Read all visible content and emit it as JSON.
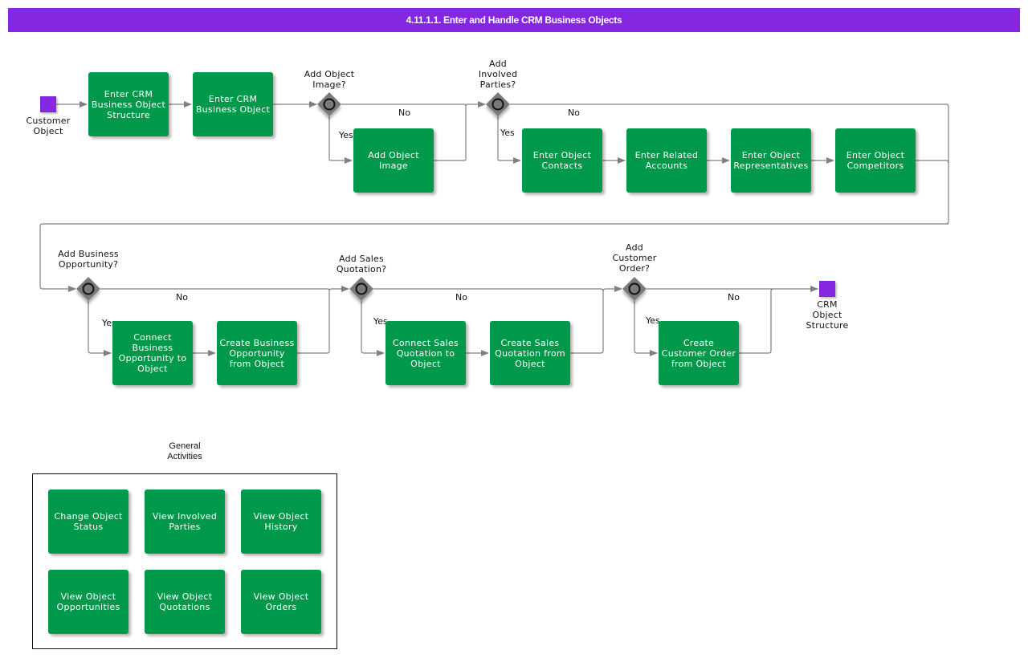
{
  "title": "4.11.1.1. Enter and Handle CRM Business Objects",
  "colors": {
    "header": "#8526e0",
    "task": "#00984a",
    "event": "#8526e0",
    "gateway": "#7a7a7a",
    "connector": "#808080"
  },
  "events": {
    "start": {
      "label": "Customer\nObject",
      "icon": "start-event-square"
    },
    "end": {
      "label": "CRM\nObject\nStructure",
      "icon": "end-event-square"
    }
  },
  "tasks": {
    "t1": "Enter CRM Business Object Structure",
    "t2": "Enter CRM Business Object",
    "t3": "Add Object Image",
    "t4": "Enter Object Contacts",
    "t5": "Enter Related Accounts",
    "t6": "Enter Object Representatives",
    "t7": "Enter Object Competitors",
    "t8": "Connect Business Opportunity to Object",
    "t9": "Create Business Opportunity from Object",
    "t10": "Connect Sales Quotation to Object",
    "t11": "Create Sales Quotation from Object",
    "t12": "Create Customer Order from Object"
  },
  "gateways": {
    "g1": "Add Object\nImage?",
    "g2": "Add\nInvolved\nParties?",
    "g3": "Add Business\nOpportunity?",
    "g4": "Add Sales\nQuotation?",
    "g5": "Add\nCustomer\nOrder?"
  },
  "flow_labels": {
    "yes": "Yes",
    "no": "No"
  },
  "general_activities": {
    "title": "General\nActivities",
    "items": [
      "Change Object Status",
      "View Involved Parties",
      "View Object History",
      "View Object Opportunities",
      "View Object Quotations",
      "View Object Orders"
    ]
  }
}
